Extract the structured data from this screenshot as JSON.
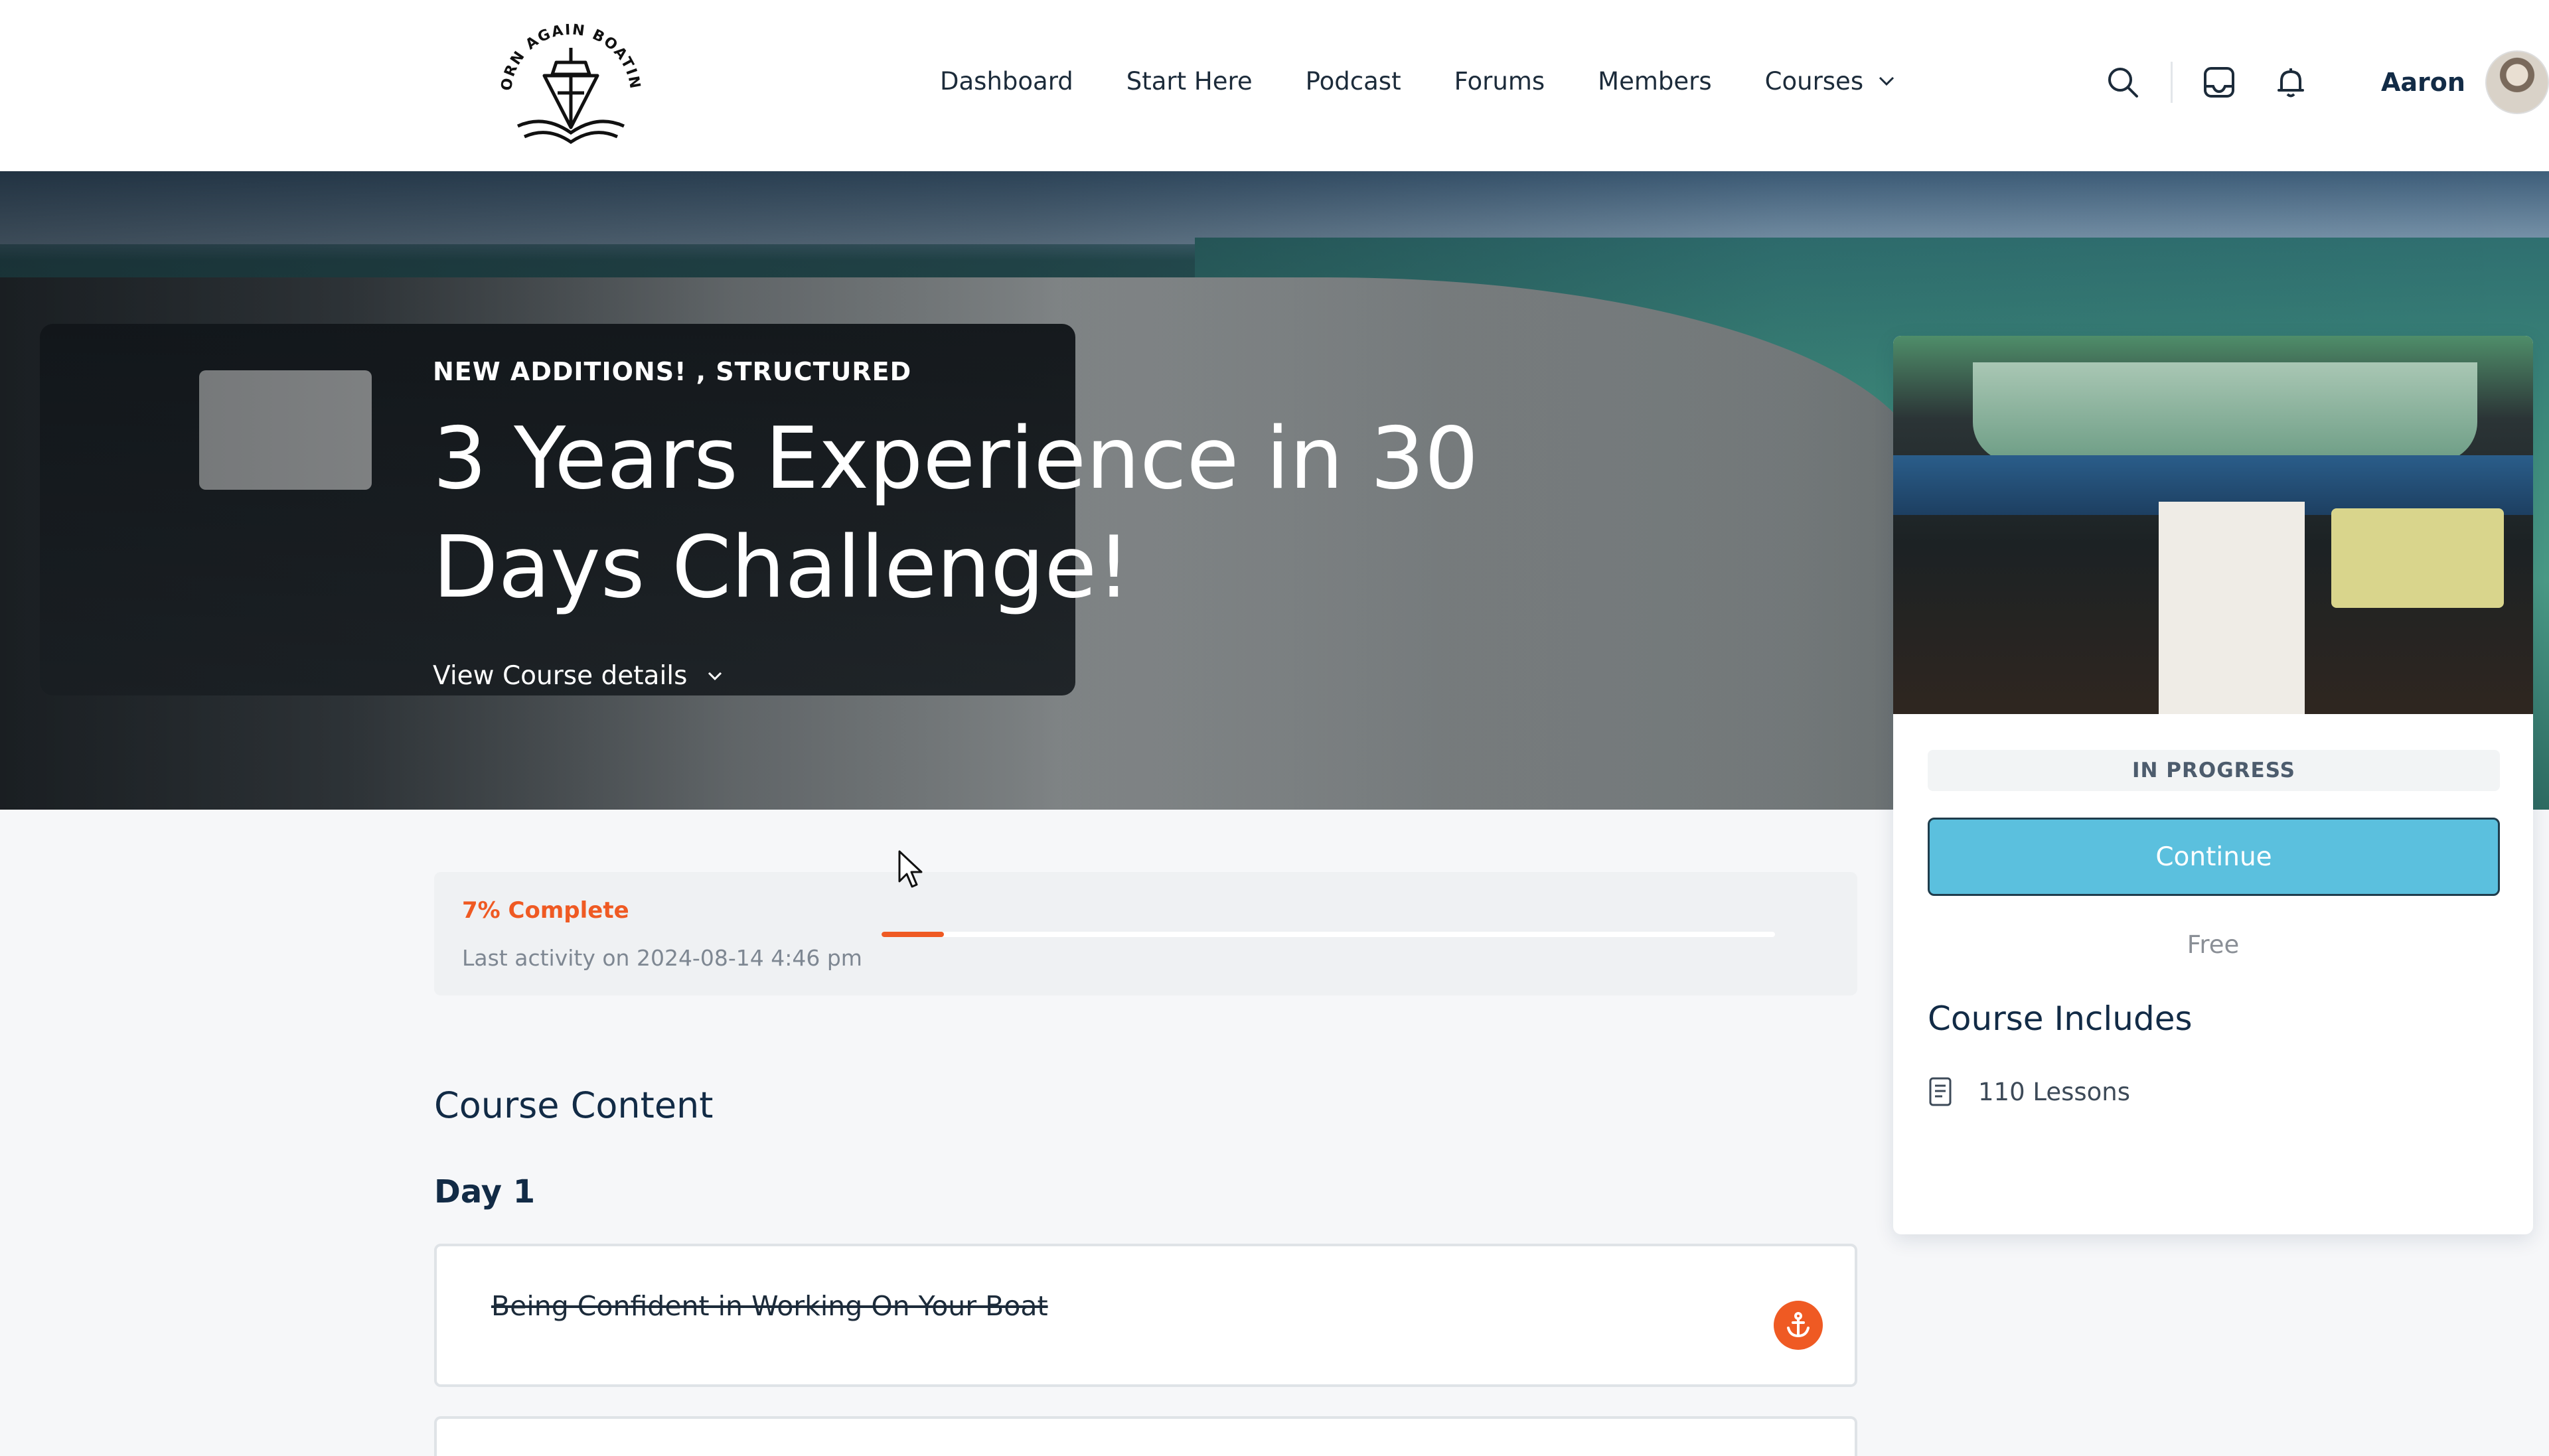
{
  "header": {
    "logo_text": "BORN AGAIN BOATING",
    "nav": [
      {
        "label": "Dashboard"
      },
      {
        "label": "Start Here"
      },
      {
        "label": "Podcast"
      },
      {
        "label": "Forums"
      },
      {
        "label": "Members"
      },
      {
        "label": "Courses",
        "has_dropdown": true
      }
    ],
    "icons": [
      "search-icon",
      "inbox-icon",
      "bell-icon"
    ],
    "user_name": "Aaron"
  },
  "hero": {
    "categories": "NEW ADDITIONS! ,  STRUCTURED",
    "title": "3 Years Experience in 30 Days Challenge!",
    "details_label": "View Course details"
  },
  "card": {
    "status": "IN PROGRESS",
    "continue_label": "Continue",
    "price": "Free",
    "includes_title": "Course Includes",
    "lessons_count": "110 Lessons"
  },
  "progress": {
    "label": "7% Complete",
    "percent": 7,
    "last_activity": "Last activity on 2024-08-14 4:46 pm"
  },
  "content": {
    "title": "Course Content",
    "sections": [
      {
        "title": "Day 1",
        "lessons": [
          {
            "title": "Being Confident in Working On Your Boat",
            "completed": true
          }
        ]
      }
    ]
  },
  "colors": {
    "accent": "#ef5a23",
    "button": "#5bc0de",
    "text": "#122b46"
  }
}
